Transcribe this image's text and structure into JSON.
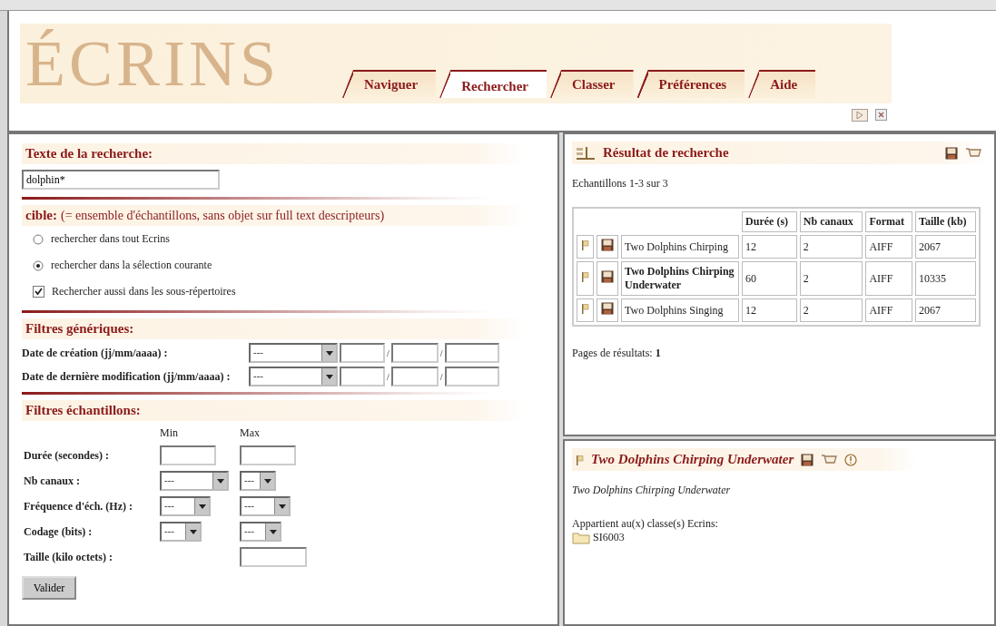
{
  "header": {
    "logo": "ÉCRINS",
    "tabs": [
      {
        "label": "Naviguer",
        "selected": false
      },
      {
        "label": "Rechercher",
        "selected": true
      },
      {
        "label": "Classer",
        "selected": false
      },
      {
        "label": "Préférences",
        "selected": false
      },
      {
        "label": "Aide",
        "selected": false
      }
    ]
  },
  "search_form": {
    "text_section": {
      "title": "Texte de la recherche:",
      "query": "dolphin*"
    },
    "target_section": {
      "title": "cible:",
      "note": "(= ensemble d'échantillons, sans objet sur full text descripteurs)",
      "options": [
        {
          "kind": "radio",
          "label": "rechercher dans tout Ecrins",
          "selected": false
        },
        {
          "kind": "radio",
          "label": "rechercher dans la sélection courante",
          "selected": true
        },
        {
          "kind": "checkbox",
          "label": "Rechercher aussi dans les sous-répertoires",
          "checked": true
        }
      ]
    },
    "generic_filters": {
      "title": "Filtres génériques:",
      "rows": [
        {
          "label": "Date de création (jj/mm/aaaa) :",
          "select": "---",
          "separator": "/"
        },
        {
          "label": "Date de dernière modification (jj/mm/aaaa) :",
          "select": "---",
          "separator": "/"
        }
      ]
    },
    "sample_filters": {
      "title": "Filtres échantillons:",
      "min_label": "Min",
      "max_label": "Max",
      "rows": [
        {
          "kind": "inputs",
          "label": "Durée (secondes) :"
        },
        {
          "kind": "selects",
          "label": "Nb canaux :",
          "min": "---",
          "max": "---"
        },
        {
          "kind": "selects",
          "label": "Fréquence d'éch. (Hz) :",
          "min": "---",
          "max": "---"
        },
        {
          "kind": "selects",
          "label": "Codage (bits) :",
          "min": "---",
          "max": "---"
        },
        {
          "kind": "max_input",
          "label": "Taille (kilo octets) :"
        }
      ]
    },
    "submit": "Valider"
  },
  "results": {
    "title": "Résultat de recherche",
    "summary": "Echantillons 1-3 sur 3",
    "columns": [
      "Durée (s)",
      "Nb canaux",
      "Format",
      "Taille (kb)"
    ],
    "rows": [
      {
        "name": "Two Dolphins Chirping",
        "duration": "12",
        "channels": "2",
        "format": "AIFF",
        "size": "2067",
        "selected": false
      },
      {
        "name": "Two Dolphins Chirping Underwater",
        "duration": "60",
        "channels": "2",
        "format": "AIFF",
        "size": "10335",
        "selected": true
      },
      {
        "name": "Two Dolphins Singing",
        "duration": "12",
        "channels": "2",
        "format": "AIFF",
        "size": "2067",
        "selected": false
      }
    ],
    "pages_label": "Pages de résultats:",
    "page": "1"
  },
  "detail": {
    "title": "Two Dolphins Chirping Underwater",
    "description": "Two Dolphins Chirping Underwater",
    "classes_label": "Appartient au(x) classe(s) Ecrins:",
    "classes": [
      "SI6003"
    ]
  }
}
